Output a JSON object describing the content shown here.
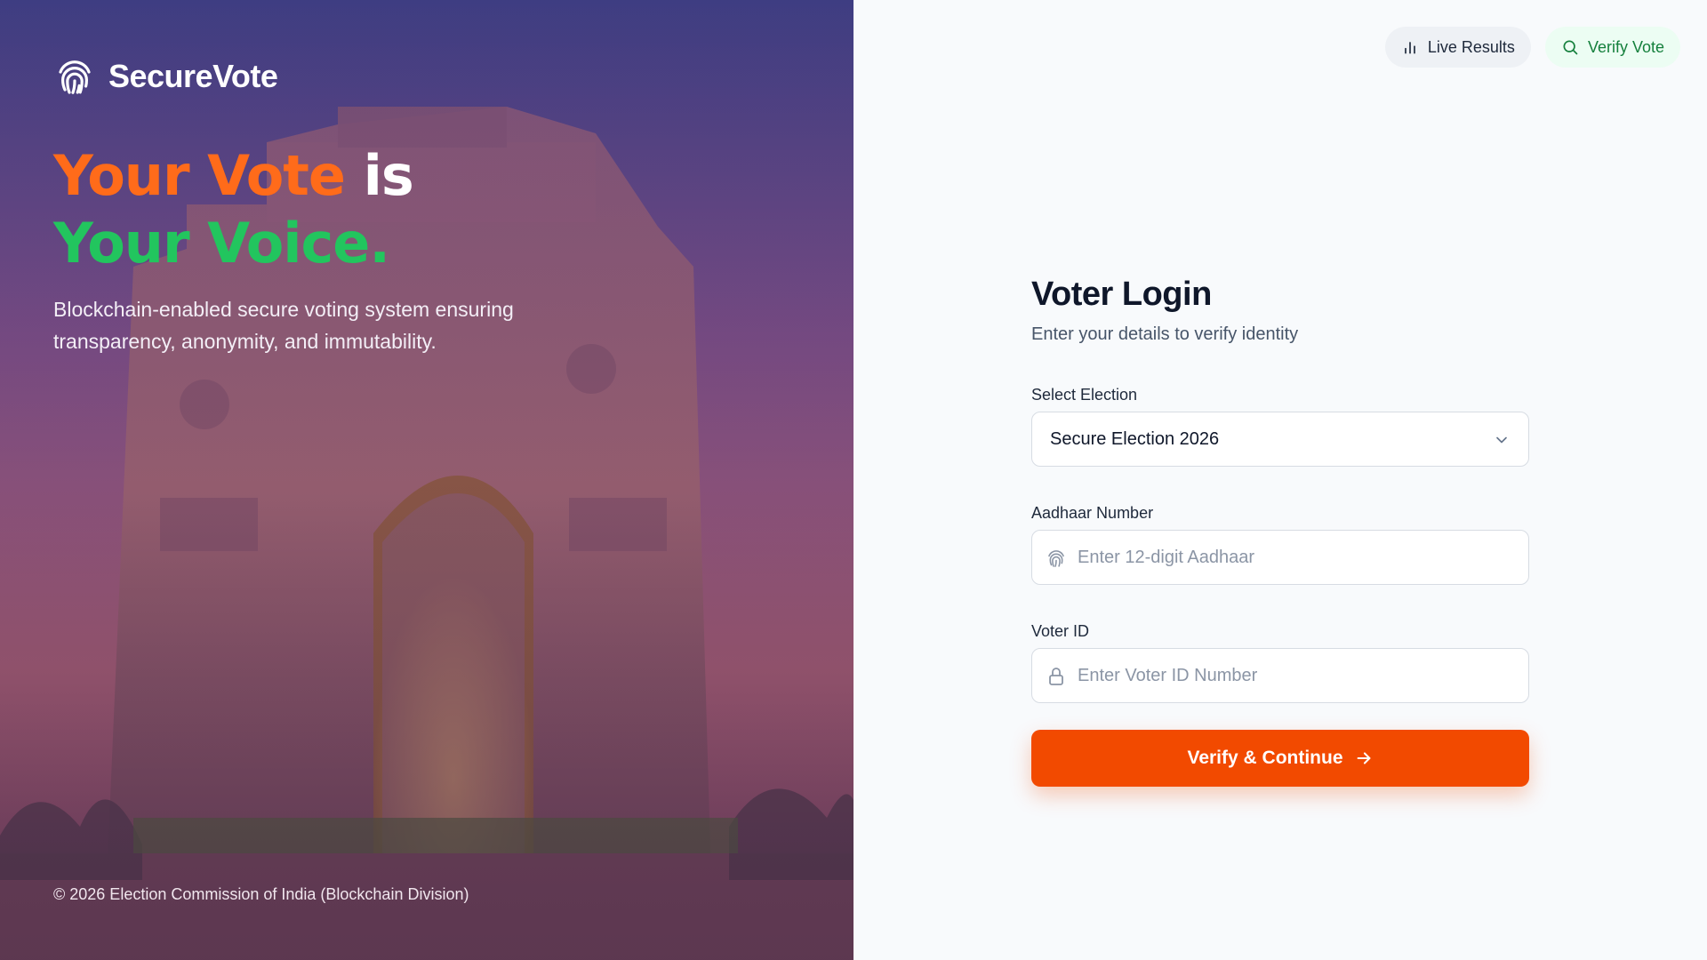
{
  "brand": {
    "name": "SecureVote",
    "icon": "fingerprint-icon"
  },
  "hero": {
    "headline_part1": "Your Vote",
    "headline_part2": " is",
    "headline_part3": "Your Voice.",
    "tagline": "Blockchain-enabled secure voting system ensuring transparency, anonymity, and immutability.",
    "copyright": "© 2026 Election Commission of India (Blockchain Division)"
  },
  "nav": {
    "live_results_label": "Live Results",
    "live_results_icon": "bar-chart-icon",
    "verify_vote_label": "Verify Vote",
    "verify_vote_icon": "search-icon"
  },
  "login": {
    "title": "Voter Login",
    "subtitle": "Enter your details to verify identity",
    "election_label": "Select Election",
    "election_value": "Secure Election 2026",
    "aadhaar_label": "Aadhaar Number",
    "aadhaar_placeholder": "Enter 12-digit Aadhaar",
    "voter_id_label": "Voter ID",
    "voter_id_placeholder": "Enter Voter ID Number",
    "submit_label": "Verify & Continue"
  },
  "colors": {
    "accent_orange": "#f24a00",
    "headline_orange": "#ff6b1a",
    "headline_green": "#22c55e",
    "verify_green": "#15803d"
  }
}
